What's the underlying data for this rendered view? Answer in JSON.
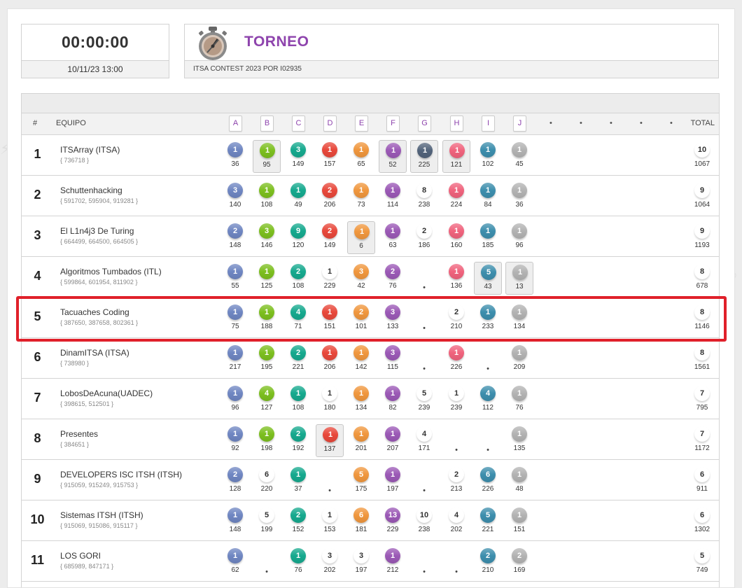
{
  "timer": {
    "clock": "00:00:00",
    "start": "10/11/23 13:00"
  },
  "contest": {
    "title": "TORNEO",
    "subtitle": "ITSA CONTEST 2023 POR I02935"
  },
  "header": {
    "rank_label": "#",
    "team_label": "EQUIPO",
    "total_label": "TOTAL"
  },
  "problems": [
    "A",
    "B",
    "C",
    "D",
    "E",
    "F",
    "G",
    "H",
    "I",
    "J",
    "•",
    "•",
    "•",
    "•",
    "•"
  ],
  "problem_colors": {
    "A": "#6f86c2",
    "B": "#7cbf1f",
    "C": "#16a98e",
    "D": "#e8483b",
    "E": "#f0973e",
    "F": "#9b59b6",
    "G": "#52637a",
    "H": "#f0637d",
    "I": "#3d8ead",
    "J": "#b3b3b3"
  },
  "teams": [
    {
      "rank": "1",
      "name": "ITSArray (ITSA)",
      "members": "{ 736718 }",
      "solved": "10",
      "time": "1067",
      "cells": [
        {
          "v": "1",
          "t": "36",
          "s": 1
        },
        {
          "v": "1",
          "t": "95",
          "s": 1,
          "b": 1
        },
        {
          "v": "3",
          "t": "149",
          "s": 1
        },
        {
          "v": "1",
          "t": "157",
          "s": 1
        },
        {
          "v": "1",
          "t": "65",
          "s": 1
        },
        {
          "v": "1",
          "t": "52",
          "s": 1,
          "b": 1
        },
        {
          "v": "1",
          "t": "225",
          "s": 1,
          "b": 1
        },
        {
          "v": "1",
          "t": "121",
          "s": 1,
          "b": 1
        },
        {
          "v": "1",
          "t": "102",
          "s": 1
        },
        {
          "v": "1",
          "t": "45",
          "s": 1
        }
      ]
    },
    {
      "rank": "2",
      "name": "Schuttenhacking",
      "members": "{ 591702, 595904, 919281 }",
      "solved": "9",
      "time": "1064",
      "cells": [
        {
          "v": "3",
          "t": "140",
          "s": 1
        },
        {
          "v": "1",
          "t": "108",
          "s": 1
        },
        {
          "v": "1",
          "t": "49",
          "s": 1
        },
        {
          "v": "2",
          "t": "206",
          "s": 1
        },
        {
          "v": "1",
          "t": "73",
          "s": 1
        },
        {
          "v": "1",
          "t": "114",
          "s": 1
        },
        {
          "v": "8",
          "t": "238",
          "s": 0
        },
        {
          "v": "1",
          "t": "224",
          "s": 1
        },
        {
          "v": "1",
          "t": "84",
          "s": 1
        },
        {
          "v": "1",
          "t": "36",
          "s": 1
        }
      ]
    },
    {
      "rank": "3",
      "name": "El L1n4j3 De Turing",
      "members": "{ 664499, 664500, 664505 }",
      "solved": "9",
      "time": "1193",
      "cells": [
        {
          "v": "2",
          "t": "148",
          "s": 1
        },
        {
          "v": "3",
          "t": "146",
          "s": 1
        },
        {
          "v": "9",
          "t": "120",
          "s": 1
        },
        {
          "v": "2",
          "t": "149",
          "s": 1
        },
        {
          "v": "1",
          "t": "6",
          "s": 1,
          "b": 1
        },
        {
          "v": "1",
          "t": "63",
          "s": 1
        },
        {
          "v": "2",
          "t": "186",
          "s": 0
        },
        {
          "v": "1",
          "t": "160",
          "s": 1
        },
        {
          "v": "1",
          "t": "185",
          "s": 1
        },
        {
          "v": "1",
          "t": "96",
          "s": 1
        }
      ]
    },
    {
      "rank": "4",
      "name": "Algoritmos Tumbados (ITL)",
      "members": "{ 599864, 601954, 811902 }",
      "solved": "8",
      "time": "678",
      "cells": [
        {
          "v": "1",
          "t": "55",
          "s": 1
        },
        {
          "v": "1",
          "t": "125",
          "s": 1
        },
        {
          "v": "2",
          "t": "108",
          "s": 1
        },
        {
          "v": "1",
          "t": "229",
          "s": 0
        },
        {
          "v": "3",
          "t": "42",
          "s": 1
        },
        {
          "v": "2",
          "t": "76",
          "s": 1
        },
        {
          "d": 1
        },
        {
          "v": "1",
          "t": "136",
          "s": 1
        },
        {
          "v": "5",
          "t": "43",
          "s": 1,
          "b": 1
        },
        {
          "v": "1",
          "t": "13",
          "s": 1,
          "b": 1
        }
      ]
    },
    {
      "rank": "5",
      "name": "Tacuaches Coding",
      "members": "{ 387650, 387658, 802361 }",
      "solved": "8",
      "time": "1146",
      "cells": [
        {
          "v": "1",
          "t": "75",
          "s": 1
        },
        {
          "v": "1",
          "t": "188",
          "s": 1
        },
        {
          "v": "4",
          "t": "71",
          "s": 1
        },
        {
          "v": "1",
          "t": "151",
          "s": 1
        },
        {
          "v": "2",
          "t": "101",
          "s": 1
        },
        {
          "v": "3",
          "t": "133",
          "s": 1
        },
        {
          "d": 1
        },
        {
          "v": "2",
          "t": "210",
          "s": 0
        },
        {
          "v": "1",
          "t": "233",
          "s": 1
        },
        {
          "v": "1",
          "t": "134",
          "s": 1
        }
      ]
    },
    {
      "rank": "6",
      "name": "DinamITSA (ITSA)",
      "members": "{ 738980 }",
      "solved": "8",
      "time": "1561",
      "cells": [
        {
          "v": "1",
          "t": "217",
          "s": 1
        },
        {
          "v": "1",
          "t": "195",
          "s": 1
        },
        {
          "v": "2",
          "t": "221",
          "s": 1
        },
        {
          "v": "1",
          "t": "206",
          "s": 1
        },
        {
          "v": "1",
          "t": "142",
          "s": 1
        },
        {
          "v": "3",
          "t": "115",
          "s": 1
        },
        {
          "d": 1
        },
        {
          "v": "1",
          "t": "226",
          "s": 1
        },
        {
          "d": 1
        },
        {
          "v": "1",
          "t": "209",
          "s": 1
        }
      ]
    },
    {
      "rank": "7",
      "name": "LobosDeAcuna(UADEC)",
      "members": "{ 398615, 512501 }",
      "solved": "7",
      "time": "795",
      "cells": [
        {
          "v": "1",
          "t": "96",
          "s": 1
        },
        {
          "v": "4",
          "t": "127",
          "s": 1
        },
        {
          "v": "1",
          "t": "108",
          "s": 1
        },
        {
          "v": "1",
          "t": "180",
          "s": 0
        },
        {
          "v": "1",
          "t": "134",
          "s": 1
        },
        {
          "v": "1",
          "t": "82",
          "s": 1
        },
        {
          "v": "5",
          "t": "239",
          "s": 0
        },
        {
          "v": "1",
          "t": "239",
          "s": 0
        },
        {
          "v": "4",
          "t": "112",
          "s": 1
        },
        {
          "v": "1",
          "t": "76",
          "s": 1
        }
      ]
    },
    {
      "rank": "8",
      "name": "Presentes",
      "members": "{ 384651 }",
      "solved": "7",
      "time": "1172",
      "cells": [
        {
          "v": "1",
          "t": "92",
          "s": 1
        },
        {
          "v": "1",
          "t": "198",
          "s": 1
        },
        {
          "v": "2",
          "t": "192",
          "s": 1
        },
        {
          "v": "1",
          "t": "137",
          "s": 1,
          "b": 1
        },
        {
          "v": "1",
          "t": "201",
          "s": 1
        },
        {
          "v": "1",
          "t": "207",
          "s": 1
        },
        {
          "v": "4",
          "t": "171",
          "s": 0
        },
        {
          "d": 1
        },
        {
          "d": 1
        },
        {
          "v": "1",
          "t": "135",
          "s": 1
        }
      ]
    },
    {
      "rank": "9",
      "name": "DEVELOPERS ISC ITSH (ITSH)",
      "members": "{ 915059, 915249, 915753 }",
      "solved": "6",
      "time": "911",
      "cells": [
        {
          "v": "2",
          "t": "128",
          "s": 1
        },
        {
          "v": "6",
          "t": "220",
          "s": 0
        },
        {
          "v": "1",
          "t": "37",
          "s": 1
        },
        {
          "d": 1
        },
        {
          "v": "5",
          "t": "175",
          "s": 1
        },
        {
          "v": "1",
          "t": "197",
          "s": 1
        },
        {
          "d": 1
        },
        {
          "v": "2",
          "t": "213",
          "s": 0
        },
        {
          "v": "6",
          "t": "226",
          "s": 1
        },
        {
          "v": "1",
          "t": "48",
          "s": 1
        }
      ]
    },
    {
      "rank": "10",
      "name": "Sistemas ITSH (ITSH)",
      "members": "{ 915069, 915086, 915117 }",
      "solved": "6",
      "time": "1302",
      "cells": [
        {
          "v": "1",
          "t": "148",
          "s": 1
        },
        {
          "v": "5",
          "t": "199",
          "s": 0
        },
        {
          "v": "2",
          "t": "152",
          "s": 1
        },
        {
          "v": "1",
          "t": "153",
          "s": 0
        },
        {
          "v": "6",
          "t": "181",
          "s": 1
        },
        {
          "v": "13",
          "t": "229",
          "s": 1
        },
        {
          "v": "10",
          "t": "238",
          "s": 0
        },
        {
          "v": "4",
          "t": "202",
          "s": 0
        },
        {
          "v": "5",
          "t": "221",
          "s": 1
        },
        {
          "v": "1",
          "t": "151",
          "s": 1
        }
      ]
    },
    {
      "rank": "11",
      "name": "LOS GORI",
      "members": "{ 685989, 847171 }",
      "solved": "5",
      "time": "749",
      "cells": [
        {
          "v": "1",
          "t": "62",
          "s": 1
        },
        {
          "d": 1
        },
        {
          "v": "1",
          "t": "76",
          "s": 1
        },
        {
          "v": "3",
          "t": "202",
          "s": 0
        },
        {
          "v": "3",
          "t": "197",
          "s": 0
        },
        {
          "v": "1",
          "t": "212",
          "s": 1
        },
        {
          "d": 1
        },
        {
          "d": 1
        },
        {
          "v": "2",
          "t": "210",
          "s": 1
        },
        {
          "v": "2",
          "t": "169",
          "s": 1
        }
      ]
    }
  ]
}
